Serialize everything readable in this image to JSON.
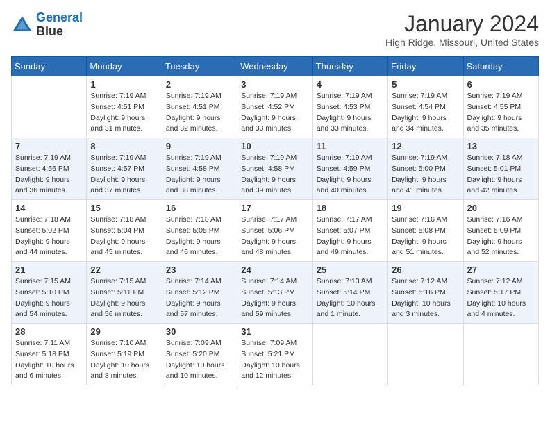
{
  "header": {
    "logo_line1": "General",
    "logo_line2": "Blue",
    "month": "January 2024",
    "location": "High Ridge, Missouri, United States"
  },
  "weekdays": [
    "Sunday",
    "Monday",
    "Tuesday",
    "Wednesday",
    "Thursday",
    "Friday",
    "Saturday"
  ],
  "weeks": [
    [
      {
        "day": "",
        "sunrise": "",
        "sunset": "",
        "daylight": ""
      },
      {
        "day": "1",
        "sunrise": "Sunrise: 7:19 AM",
        "sunset": "Sunset: 4:51 PM",
        "daylight": "Daylight: 9 hours and 31 minutes."
      },
      {
        "day": "2",
        "sunrise": "Sunrise: 7:19 AM",
        "sunset": "Sunset: 4:51 PM",
        "daylight": "Daylight: 9 hours and 32 minutes."
      },
      {
        "day": "3",
        "sunrise": "Sunrise: 7:19 AM",
        "sunset": "Sunset: 4:52 PM",
        "daylight": "Daylight: 9 hours and 33 minutes."
      },
      {
        "day": "4",
        "sunrise": "Sunrise: 7:19 AM",
        "sunset": "Sunset: 4:53 PM",
        "daylight": "Daylight: 9 hours and 33 minutes."
      },
      {
        "day": "5",
        "sunrise": "Sunrise: 7:19 AM",
        "sunset": "Sunset: 4:54 PM",
        "daylight": "Daylight: 9 hours and 34 minutes."
      },
      {
        "day": "6",
        "sunrise": "Sunrise: 7:19 AM",
        "sunset": "Sunset: 4:55 PM",
        "daylight": "Daylight: 9 hours and 35 minutes."
      }
    ],
    [
      {
        "day": "7",
        "sunrise": "Sunrise: 7:19 AM",
        "sunset": "Sunset: 4:56 PM",
        "daylight": "Daylight: 9 hours and 36 minutes."
      },
      {
        "day": "8",
        "sunrise": "Sunrise: 7:19 AM",
        "sunset": "Sunset: 4:57 PM",
        "daylight": "Daylight: 9 hours and 37 minutes."
      },
      {
        "day": "9",
        "sunrise": "Sunrise: 7:19 AM",
        "sunset": "Sunset: 4:58 PM",
        "daylight": "Daylight: 9 hours and 38 minutes."
      },
      {
        "day": "10",
        "sunrise": "Sunrise: 7:19 AM",
        "sunset": "Sunset: 4:58 PM",
        "daylight": "Daylight: 9 hours and 39 minutes."
      },
      {
        "day": "11",
        "sunrise": "Sunrise: 7:19 AM",
        "sunset": "Sunset: 4:59 PM",
        "daylight": "Daylight: 9 hours and 40 minutes."
      },
      {
        "day": "12",
        "sunrise": "Sunrise: 7:19 AM",
        "sunset": "Sunset: 5:00 PM",
        "daylight": "Daylight: 9 hours and 41 minutes."
      },
      {
        "day": "13",
        "sunrise": "Sunrise: 7:18 AM",
        "sunset": "Sunset: 5:01 PM",
        "daylight": "Daylight: 9 hours and 42 minutes."
      }
    ],
    [
      {
        "day": "14",
        "sunrise": "Sunrise: 7:18 AM",
        "sunset": "Sunset: 5:02 PM",
        "daylight": "Daylight: 9 hours and 44 minutes."
      },
      {
        "day": "15",
        "sunrise": "Sunrise: 7:18 AM",
        "sunset": "Sunset: 5:04 PM",
        "daylight": "Daylight: 9 hours and 45 minutes."
      },
      {
        "day": "16",
        "sunrise": "Sunrise: 7:18 AM",
        "sunset": "Sunset: 5:05 PM",
        "daylight": "Daylight: 9 hours and 46 minutes."
      },
      {
        "day": "17",
        "sunrise": "Sunrise: 7:17 AM",
        "sunset": "Sunset: 5:06 PM",
        "daylight": "Daylight: 9 hours and 48 minutes."
      },
      {
        "day": "18",
        "sunrise": "Sunrise: 7:17 AM",
        "sunset": "Sunset: 5:07 PM",
        "daylight": "Daylight: 9 hours and 49 minutes."
      },
      {
        "day": "19",
        "sunrise": "Sunrise: 7:16 AM",
        "sunset": "Sunset: 5:08 PM",
        "daylight": "Daylight: 9 hours and 51 minutes."
      },
      {
        "day": "20",
        "sunrise": "Sunrise: 7:16 AM",
        "sunset": "Sunset: 5:09 PM",
        "daylight": "Daylight: 9 hours and 52 minutes."
      }
    ],
    [
      {
        "day": "21",
        "sunrise": "Sunrise: 7:15 AM",
        "sunset": "Sunset: 5:10 PM",
        "daylight": "Daylight: 9 hours and 54 minutes."
      },
      {
        "day": "22",
        "sunrise": "Sunrise: 7:15 AM",
        "sunset": "Sunset: 5:11 PM",
        "daylight": "Daylight: 9 hours and 56 minutes."
      },
      {
        "day": "23",
        "sunrise": "Sunrise: 7:14 AM",
        "sunset": "Sunset: 5:12 PM",
        "daylight": "Daylight: 9 hours and 57 minutes."
      },
      {
        "day": "24",
        "sunrise": "Sunrise: 7:14 AM",
        "sunset": "Sunset: 5:13 PM",
        "daylight": "Daylight: 9 hours and 59 minutes."
      },
      {
        "day": "25",
        "sunrise": "Sunrise: 7:13 AM",
        "sunset": "Sunset: 5:14 PM",
        "daylight": "Daylight: 10 hours and 1 minute."
      },
      {
        "day": "26",
        "sunrise": "Sunrise: 7:12 AM",
        "sunset": "Sunset: 5:16 PM",
        "daylight": "Daylight: 10 hours and 3 minutes."
      },
      {
        "day": "27",
        "sunrise": "Sunrise: 7:12 AM",
        "sunset": "Sunset: 5:17 PM",
        "daylight": "Daylight: 10 hours and 4 minutes."
      }
    ],
    [
      {
        "day": "28",
        "sunrise": "Sunrise: 7:11 AM",
        "sunset": "Sunset: 5:18 PM",
        "daylight": "Daylight: 10 hours and 6 minutes."
      },
      {
        "day": "29",
        "sunrise": "Sunrise: 7:10 AM",
        "sunset": "Sunset: 5:19 PM",
        "daylight": "Daylight: 10 hours and 8 minutes."
      },
      {
        "day": "30",
        "sunrise": "Sunrise: 7:09 AM",
        "sunset": "Sunset: 5:20 PM",
        "daylight": "Daylight: 10 hours and 10 minutes."
      },
      {
        "day": "31",
        "sunrise": "Sunrise: 7:09 AM",
        "sunset": "Sunset: 5:21 PM",
        "daylight": "Daylight: 10 hours and 12 minutes."
      },
      {
        "day": "",
        "sunrise": "",
        "sunset": "",
        "daylight": ""
      },
      {
        "day": "",
        "sunrise": "",
        "sunset": "",
        "daylight": ""
      },
      {
        "day": "",
        "sunrise": "",
        "sunset": "",
        "daylight": ""
      }
    ]
  ]
}
